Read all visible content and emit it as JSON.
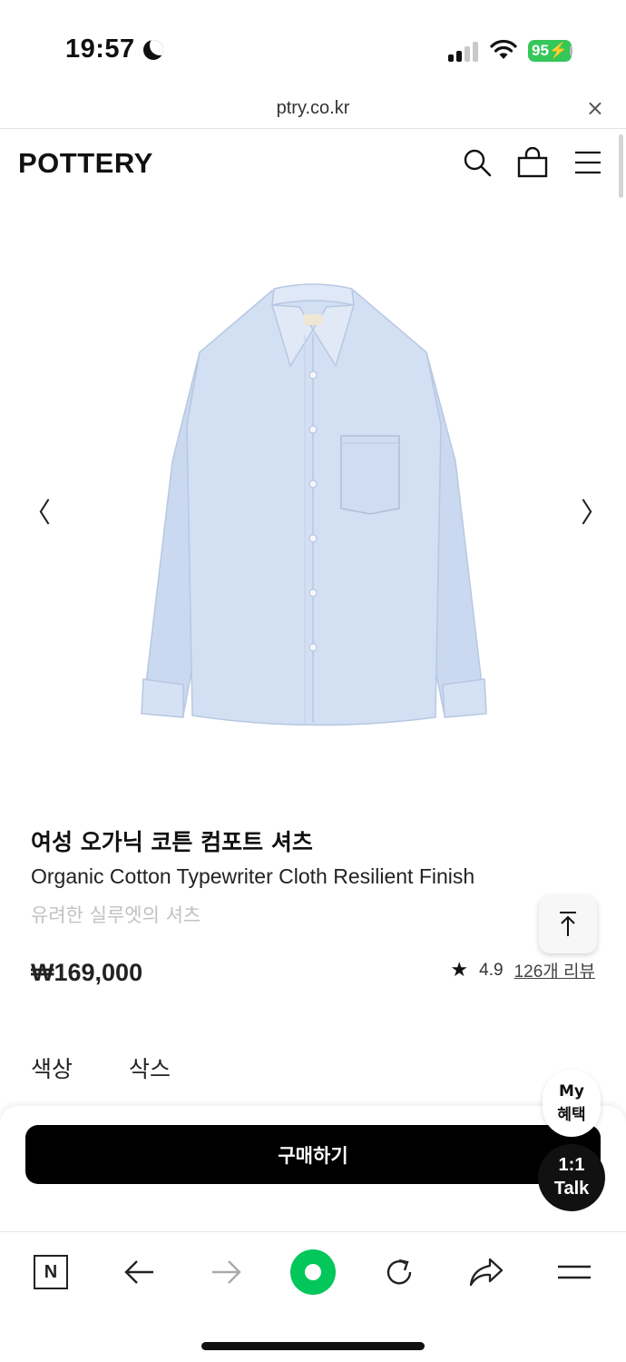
{
  "status_bar": {
    "time": "19:57",
    "battery": "95"
  },
  "browser": {
    "url": "ptry.co.kr",
    "close_glyph": "×"
  },
  "header": {
    "logo": "POTTERY",
    "icons": [
      "search-icon",
      "bag-icon",
      "menu-icon"
    ]
  },
  "gallery": {
    "prev_glyph": "〈",
    "next_glyph": "〉",
    "image_subject": "light blue oxford shirt"
  },
  "product": {
    "name_ko": "여성 오가닉 코튼 컴포트 셔츠",
    "name_en": "Organic Cotton Typewriter Cloth Resilient Finish",
    "description": "유려한 실루엣의 셔츠",
    "price": "₩169,000",
    "rating": "4.9",
    "reviews": "126개 리뷰"
  },
  "options": {
    "color_label": "색상",
    "size_label": "삭스"
  },
  "actions": {
    "buy_label": "구매하기",
    "my_benefit_line1": "My",
    "my_benefit_line2": "혜택",
    "talk_line1": "1:1",
    "talk_line2": "Talk"
  },
  "toolbar": {
    "naver_label": "N"
  },
  "colors": {
    "accent_green": "#03c75a",
    "battery_green": "#35c759",
    "shirt_blue": "#cfdcf2"
  }
}
